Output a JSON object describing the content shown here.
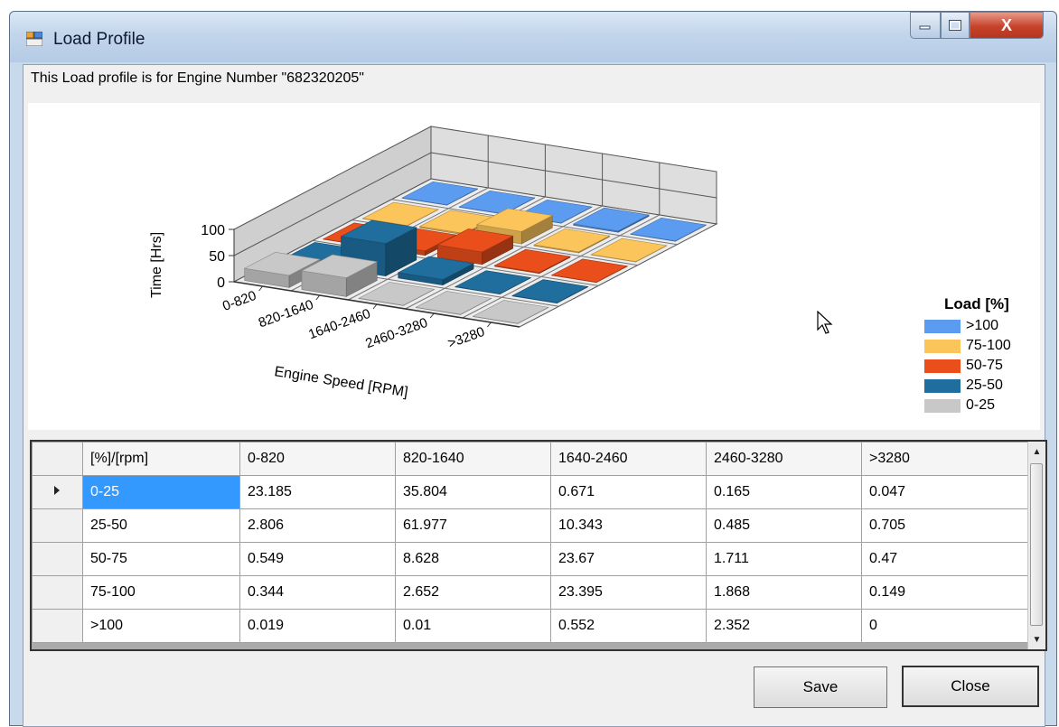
{
  "window": {
    "title": "Load Profile",
    "close_glyph": "X"
  },
  "info_label": "This Load profile is for Engine Number \"682320205\"",
  "chart_data": {
    "type": "bar",
    "subtype": "3d-column",
    "xlabel": "Engine Speed [RPM]",
    "ylabel": "Time [Hrs]",
    "yticks": [
      0,
      50,
      100
    ],
    "categories": [
      "0-820",
      "820-1640",
      "1640-2460",
      "2460-3280",
      ">3280"
    ],
    "legend_title": "Load [%]",
    "legend_position": "right",
    "series": [
      {
        "name": ">100",
        "color": "#5b9bf0",
        "values": [
          0.019,
          0.01,
          0.552,
          2.352,
          0
        ]
      },
      {
        "name": "75-100",
        "color": "#fbc55c",
        "values": [
          0.344,
          2.652,
          23.395,
          1.868,
          0.149
        ]
      },
      {
        "name": "50-75",
        "color": "#e94e1b",
        "values": [
          0.549,
          8.628,
          23.67,
          1.711,
          0.47
        ]
      },
      {
        "name": "25-50",
        "color": "#1f6e9e",
        "values": [
          2.806,
          61.977,
          10.343,
          0.485,
          0.705
        ]
      },
      {
        "name": "0-25",
        "color": "#c8c8c8",
        "values": [
          23.185,
          35.804,
          0.671,
          0.165,
          0.047
        ]
      }
    ]
  },
  "grid": {
    "headers": [
      "[%]/[rpm]",
      "0-820",
      "820-1640",
      "1640-2460",
      "2460-3280",
      ">3280"
    ],
    "rows": [
      [
        "0-25",
        "23.185",
        "35.804",
        "0.671",
        "0.165",
        "0.047"
      ],
      [
        "25-50",
        "2.806",
        "61.977",
        "10.343",
        "0.485",
        "0.705"
      ],
      [
        "50-75",
        "0.549",
        "8.628",
        "23.67",
        "1.711",
        "0.47"
      ],
      [
        "75-100",
        "0.344",
        "2.652",
        "23.395",
        "1.868",
        "0.149"
      ],
      [
        ">100",
        "0.019",
        "0.01",
        "0.552",
        "2.352",
        "0"
      ]
    ]
  },
  "buttons": {
    "save": "Save",
    "close": "Close"
  }
}
